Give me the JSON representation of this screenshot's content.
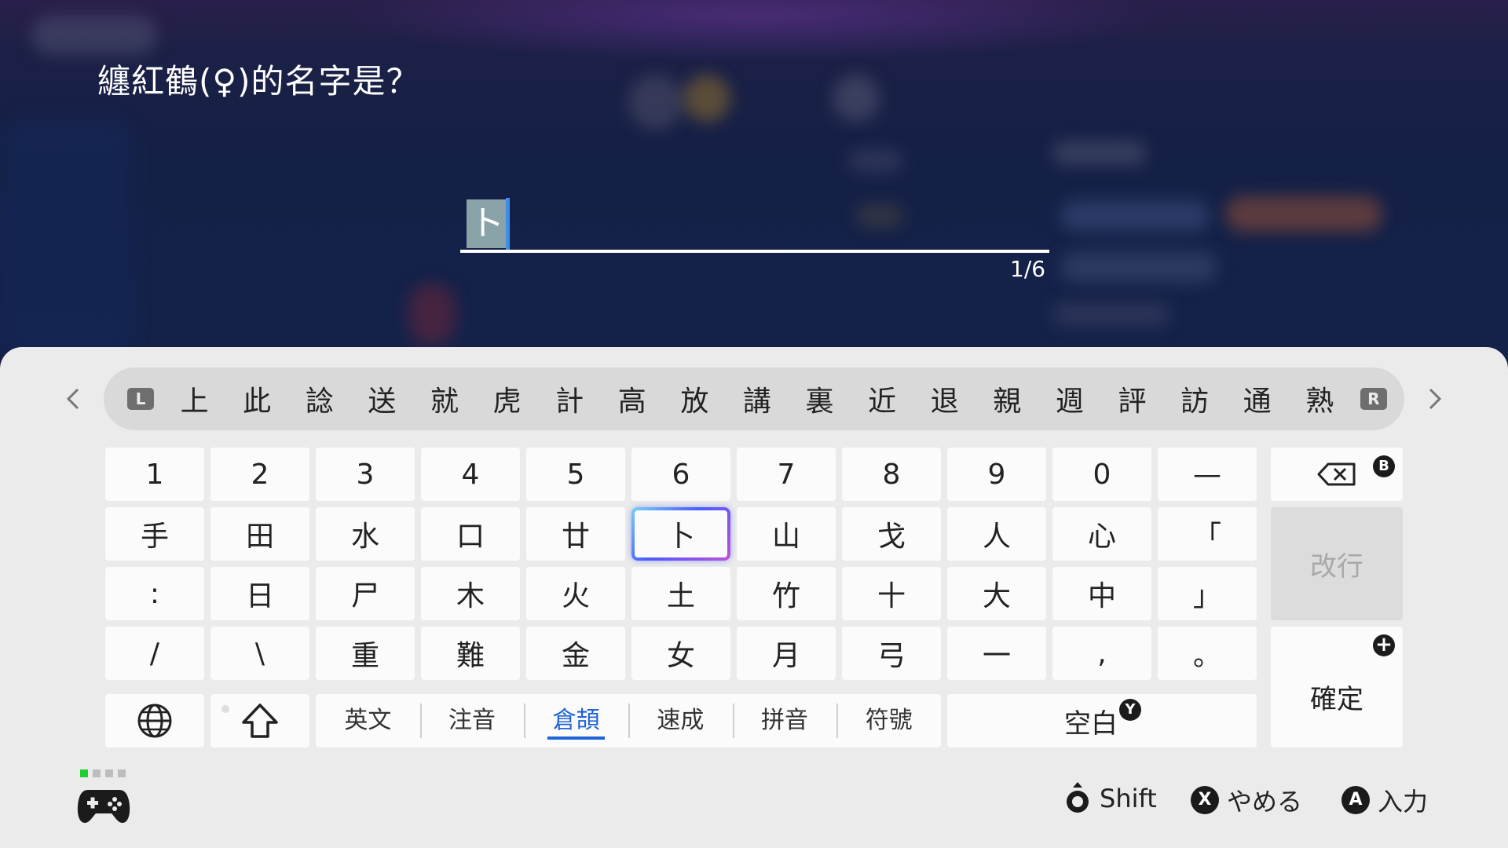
{
  "prompt": "纏紅鶴(♀)的名字是？",
  "input": {
    "composing": "ト",
    "counter": "1/6"
  },
  "candidates": {
    "left_badge": "L",
    "right_badge": "R",
    "items": [
      "上",
      "此",
      "諗",
      "送",
      "就",
      "虎",
      "計",
      "高",
      "放",
      "講",
      "裏",
      "近",
      "退",
      "親",
      "週",
      "評",
      "訪",
      "通",
      "熟"
    ]
  },
  "keys": {
    "row1": [
      "1",
      "2",
      "3",
      "4",
      "5",
      "6",
      "7",
      "8",
      "9",
      "0",
      "—"
    ],
    "row2": [
      "手",
      "田",
      "水",
      "口",
      "廿",
      "卜",
      "山",
      "戈",
      "人",
      "心",
      "「"
    ],
    "row3": [
      ":",
      "日",
      "尸",
      "木",
      "火",
      "土",
      "竹",
      "十",
      "大",
      "中",
      "」"
    ],
    "row4": [
      "/",
      "\\",
      "重",
      "難",
      "金",
      "女",
      "月",
      "弓",
      "一",
      ",",
      "。"
    ]
  },
  "side": {
    "backspace_badge": "B",
    "newline": "改行",
    "confirm": "確定",
    "confirm_badge": "+"
  },
  "modes": [
    "英文",
    "注音",
    "倉頡",
    "速成",
    "拼音",
    "符號"
  ],
  "active_mode": "倉頡",
  "space": {
    "label": "空白",
    "badge": "Y"
  },
  "footer": {
    "shift": "Shift",
    "cancel_badge": "X",
    "cancel": "やめる",
    "enter_badge": "A",
    "enter": "入力"
  },
  "colors": {
    "accent": "#1f64d6",
    "panel": "#ebebeb",
    "key": "#fbfbfb",
    "player_led": "#22cc33"
  },
  "icons": [
    "globe-icon",
    "shift-arrow-icon",
    "backspace-icon",
    "controller-icon",
    "stick-press-icon"
  ]
}
